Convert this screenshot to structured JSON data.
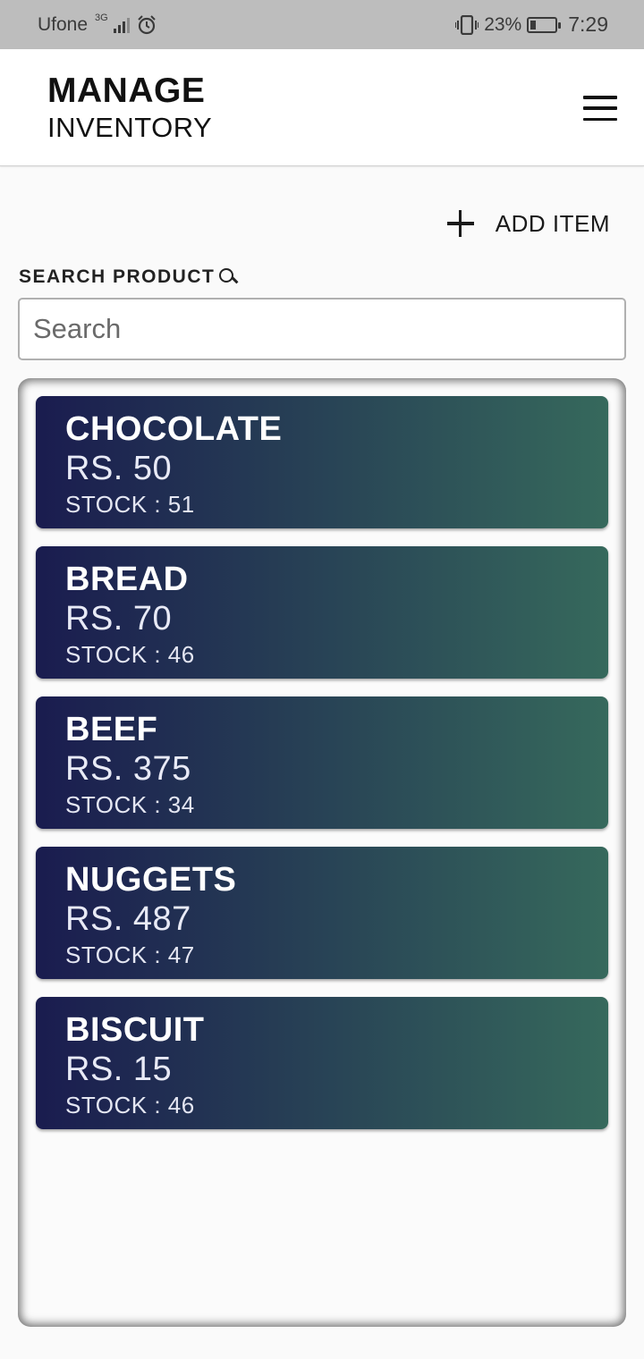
{
  "status_bar": {
    "carrier": "Ufone",
    "network": "3G",
    "battery": "23%",
    "battery_level": 0.23,
    "time": "7:29"
  },
  "header": {
    "title_line1": "MANAGE",
    "title_line2": "INVENTORY",
    "menu_icon": "hamburger-menu-icon"
  },
  "actions": {
    "add_icon": "plus-icon",
    "add_label": "ADD ITEM"
  },
  "search": {
    "label": "SEARCH PRODUCT",
    "icon": "search-icon",
    "placeholder": "Search",
    "value": ""
  },
  "products": [
    {
      "name": "CHOCOLATE",
      "price": "RS. 50",
      "stock": "STOCK : 51"
    },
    {
      "name": "BREAD",
      "price": "RS. 70",
      "stock": "STOCK : 46"
    },
    {
      "name": "BEEF",
      "price": "RS. 375",
      "stock": "STOCK : 34"
    },
    {
      "name": "NUGGETS",
      "price": "RS. 487",
      "stock": "STOCK : 47"
    },
    {
      "name": "BISCUIT",
      "price": "RS. 15",
      "stock": "STOCK : 46"
    }
  ],
  "colors": {
    "card_gradient_start": "#1a1c4f",
    "card_gradient_end": "#36695c",
    "status_bar": "#bdbdbd"
  }
}
